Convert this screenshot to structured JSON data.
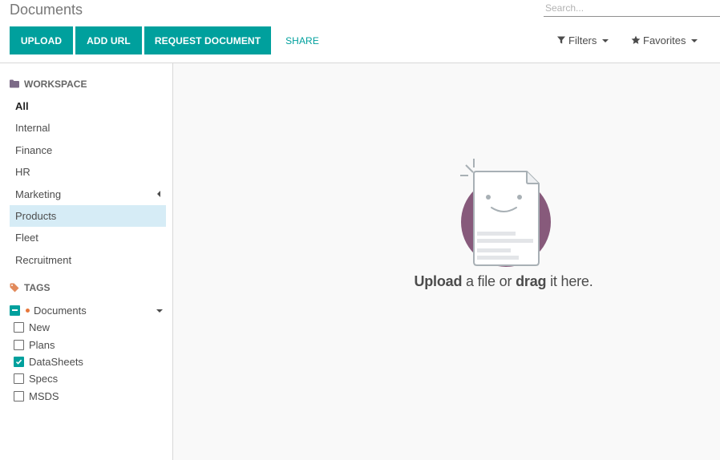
{
  "header": {
    "title": "Documents",
    "search": {
      "placeholder": "Search...",
      "value": ""
    },
    "buttons": {
      "upload": "UPLOAD",
      "add_url": "ADD URL",
      "request_document": "REQUEST DOCUMENT",
      "share": "SHARE"
    },
    "filters_label": "Filters",
    "favorites_label": "Favorites"
  },
  "sidebar": {
    "workspace_title": "WORKSPACE",
    "workspaces": [
      {
        "label": "All",
        "selected": true
      },
      {
        "label": "Internal"
      },
      {
        "label": "Finance"
      },
      {
        "label": "HR"
      },
      {
        "label": "Marketing",
        "has_children": true
      },
      {
        "label": "Products",
        "highlighted": true
      },
      {
        "label": "Fleet"
      },
      {
        "label": "Recruitment"
      }
    ],
    "tags_title": "TAGS",
    "tag_category": {
      "label": "Documents",
      "state": "indeterminate",
      "dot_color": "#e7773b"
    },
    "tags": [
      {
        "label": "New",
        "checked": false
      },
      {
        "label": "Plans",
        "checked": false
      },
      {
        "label": "DataSheets",
        "checked": true
      },
      {
        "label": "Specs",
        "checked": false
      },
      {
        "label": "MSDS",
        "checked": false
      }
    ]
  },
  "main": {
    "empty_state": {
      "word_upload": "Upload",
      "text_middle": " a file or ",
      "word_drag": "drag",
      "text_end": " it here."
    }
  },
  "colors": {
    "accent": "#00a09d",
    "highlight": "#d6ecf6",
    "illustration_circle": "#875a7b"
  },
  "icons": {
    "filters": "filter-icon",
    "favorites": "star-icon",
    "workspace": "folder-icon",
    "tags": "tag-icon"
  }
}
